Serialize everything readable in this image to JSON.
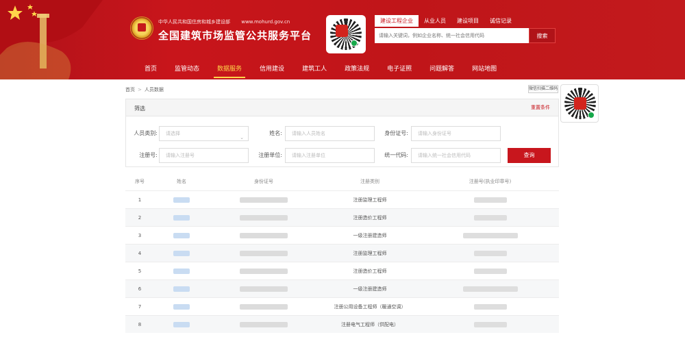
{
  "header": {
    "subtitle": "中华人民共和国住房和城乡建设部",
    "url": "www.mohurd.gov.cn",
    "title": "全国建筑市场监管公共服务平台",
    "colors": {
      "primary": "#c8161d",
      "accent": "#ffd54a"
    }
  },
  "search": {
    "tabs": [
      "建设工程企业",
      "从业人员",
      "建设项目",
      "诚信记录"
    ],
    "placeholder": "请输入关键词，例如企业名称、统一社会信用代码",
    "button": "搜索"
  },
  "nav": [
    "首页",
    "监管动态",
    "数据服务",
    "信用建设",
    "建筑工人",
    "政策法规",
    "电子证照",
    "问题解答",
    "网站地图"
  ],
  "breadcrumb": [
    "首页",
    "人员数据"
  ],
  "side_qr_label": "微信扫描二维码",
  "filter": {
    "title": "筛选",
    "reset": "重置条件",
    "person_type_label": "人员类别:",
    "person_type_value": "请选择",
    "name_label": "姓名:",
    "name_placeholder": "请输入人员姓名",
    "id_label": "身份证号:",
    "id_placeholder": "请输入身份证号",
    "cert_label": "注册号:",
    "cert_placeholder": "请输入注册号",
    "unit_label": "注册单位:",
    "unit_placeholder": "请输入注册单位",
    "credit_label": "统一代码:",
    "credit_placeholder": "请输入统一社会信用代码",
    "query_button": "查询"
  },
  "table": {
    "headers": [
      "序号",
      "姓名",
      "身份证号",
      "注册类别",
      "注册号(执业印章号)"
    ],
    "rows": [
      {
        "index": "1",
        "category": "注册监理工程师"
      },
      {
        "index": "2",
        "category": "注册造价工程师"
      },
      {
        "index": "3",
        "category": "一级注册建造师"
      },
      {
        "index": "4",
        "category": "注册监理工程师"
      },
      {
        "index": "5",
        "category": "注册造价工程师"
      },
      {
        "index": "6",
        "category": "一级注册建造师"
      },
      {
        "index": "7",
        "category": "注册公用设备工程师（暖通空调）"
      },
      {
        "index": "8",
        "category": "注册电气工程师（供配电）"
      }
    ]
  }
}
